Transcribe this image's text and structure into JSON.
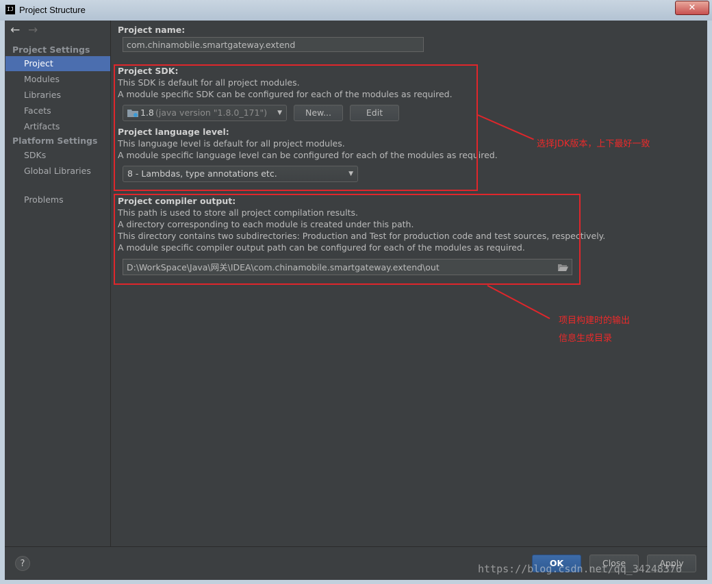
{
  "window": {
    "title": "Project Structure",
    "app_icon_text": "IJ",
    "close_label": "✕"
  },
  "sidebar": {
    "back_icon": "←",
    "forward_icon": "→",
    "project_settings_header": "Project Settings",
    "project_settings_items": [
      {
        "label": "Project",
        "selected": true
      },
      {
        "label": "Modules"
      },
      {
        "label": "Libraries"
      },
      {
        "label": "Facets"
      },
      {
        "label": "Artifacts"
      }
    ],
    "platform_settings_header": "Platform Settings",
    "platform_settings_items": [
      {
        "label": "SDKs"
      },
      {
        "label": "Global Libraries"
      }
    ],
    "problems_label": "Problems"
  },
  "main": {
    "project_name_label": "Project name:",
    "project_name_value": "com.chinamobile.smartgateway.extend",
    "sdk": {
      "title": "Project SDK:",
      "desc1": "This SDK is default for all project modules.",
      "desc2": "A module specific SDK can be configured for each of the modules as required.",
      "selected_version": "1.8",
      "selected_detail": "(java version \"1.8.0_171\")",
      "new_button": "New...",
      "edit_button": "Edit"
    },
    "language_level": {
      "title": "Project language level:",
      "desc1": "This language level is default for all project modules.",
      "desc2": "A module specific language level can be configured for each of the modules as required.",
      "selected": "8 - Lambdas, type annotations etc."
    },
    "compiler_output": {
      "title": "Project compiler output:",
      "desc1": "This path is used to store all project compilation results.",
      "desc2": "A directory corresponding to each module is created under this path.",
      "desc3": "This directory contains two subdirectories: Production and Test for production code and test sources, respectively.",
      "desc4": "A module specific compiler output path can be configured for each of the modules as required.",
      "path": "D:\\WorkSpace\\Java\\网关\\IDEA\\com.chinamobile.smartgateway.extend\\out"
    }
  },
  "annotations": {
    "sdk_note": "选择JDK版本，上下最好一致",
    "output_note_line1": "项目构建时的输出",
    "output_note_line2": "信息生成目录",
    "color": "#e0262b"
  },
  "footer": {
    "help_label": "?",
    "ok_label": "OK",
    "close_label": "Close",
    "apply_label": "Apply",
    "watermark": "https://blog.csdn.net/qq_34248376"
  },
  "colors": {
    "background": "#3c3f41",
    "selection": "#4b6eaf",
    "default_button": "#365f9c"
  }
}
